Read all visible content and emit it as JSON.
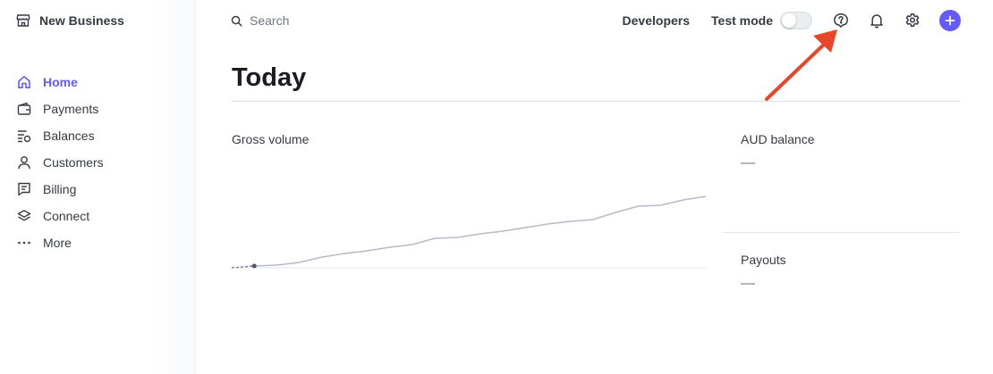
{
  "brand": {
    "name": "New Business",
    "icon": "store-icon"
  },
  "search": {
    "label": "Search",
    "icon": "search-icon"
  },
  "header": {
    "developers_label": "Developers",
    "test_mode_label": "Test mode",
    "test_mode_on": false,
    "icons": [
      "help-icon",
      "bell-icon",
      "gear-icon",
      "plus-icon"
    ]
  },
  "sidebar": {
    "items": [
      {
        "label": "Home",
        "icon": "home-icon",
        "active": true
      },
      {
        "label": "Payments",
        "icon": "wallet-icon",
        "active": false
      },
      {
        "label": "Balances",
        "icon": "balances-icon",
        "active": false
      },
      {
        "label": "Customers",
        "icon": "person-icon",
        "active": false
      },
      {
        "label": "Billing",
        "icon": "invoice-icon",
        "active": false
      },
      {
        "label": "Connect",
        "icon": "layers-icon",
        "active": false
      },
      {
        "label": "More",
        "icon": "more-icon",
        "active": false
      }
    ]
  },
  "main": {
    "title": "Today",
    "gross_volume": {
      "label": "Gross volume",
      "trend": [
        0,
        0.02,
        0.03,
        0.06,
        0.12,
        0.16,
        0.19,
        0.23,
        0.26,
        0.33,
        0.34,
        0.38,
        0.41,
        0.45,
        0.49,
        0.52,
        0.54,
        0.62,
        0.69,
        0.7,
        0.76,
        0.8
      ]
    },
    "aud_balance": {
      "label": "AUD balance",
      "value": "—"
    },
    "payouts": {
      "label": "Payouts",
      "value": "—"
    }
  },
  "colors": {
    "accent": "#635bff",
    "text": "#353a44",
    "muted": "#6c7688",
    "chart_line": "#b9b8c8",
    "annotation": "#e8462a"
  }
}
